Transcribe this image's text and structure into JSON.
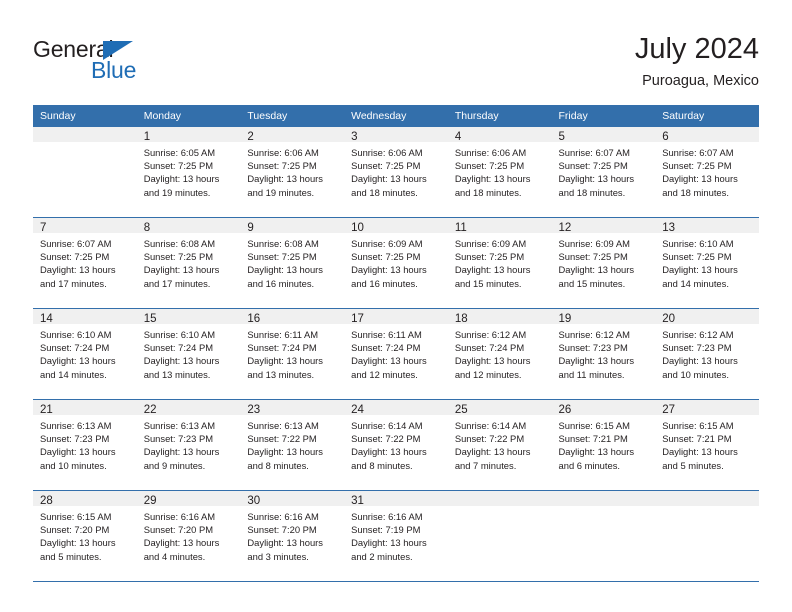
{
  "brand": {
    "name_top": "General",
    "name_bottom": "Blue",
    "triangle_icon": "blue-triangle-icon",
    "accent_color": "#1f6db5"
  },
  "header": {
    "title": "July 2024",
    "subtitle": "Puroagua, Mexico",
    "header_bg_color": "#336fab",
    "daynum_bg_color": "#f0f0f0"
  },
  "weekday_headers": [
    "Sunday",
    "Monday",
    "Tuesday",
    "Wednesday",
    "Thursday",
    "Friday",
    "Saturday"
  ],
  "weeks": [
    [
      {
        "day": "",
        "blank": true,
        "sunrise": "",
        "sunset": "",
        "daylight_line1": "",
        "daylight_line2": ""
      },
      {
        "day": "1",
        "blank": false,
        "sunrise": "Sunrise: 6:05 AM",
        "sunset": "Sunset: 7:25 PM",
        "daylight_line1": "Daylight: 13 hours",
        "daylight_line2": "and 19 minutes."
      },
      {
        "day": "2",
        "blank": false,
        "sunrise": "Sunrise: 6:06 AM",
        "sunset": "Sunset: 7:25 PM",
        "daylight_line1": "Daylight: 13 hours",
        "daylight_line2": "and 19 minutes."
      },
      {
        "day": "3",
        "blank": false,
        "sunrise": "Sunrise: 6:06 AM",
        "sunset": "Sunset: 7:25 PM",
        "daylight_line1": "Daylight: 13 hours",
        "daylight_line2": "and 18 minutes."
      },
      {
        "day": "4",
        "blank": false,
        "sunrise": "Sunrise: 6:06 AM",
        "sunset": "Sunset: 7:25 PM",
        "daylight_line1": "Daylight: 13 hours",
        "daylight_line2": "and 18 minutes."
      },
      {
        "day": "5",
        "blank": false,
        "sunrise": "Sunrise: 6:07 AM",
        "sunset": "Sunset: 7:25 PM",
        "daylight_line1": "Daylight: 13 hours",
        "daylight_line2": "and 18 minutes."
      },
      {
        "day": "6",
        "blank": false,
        "sunrise": "Sunrise: 6:07 AM",
        "sunset": "Sunset: 7:25 PM",
        "daylight_line1": "Daylight: 13 hours",
        "daylight_line2": "and 18 minutes."
      }
    ],
    [
      {
        "day": "7",
        "blank": false,
        "sunrise": "Sunrise: 6:07 AM",
        "sunset": "Sunset: 7:25 PM",
        "daylight_line1": "Daylight: 13 hours",
        "daylight_line2": "and 17 minutes."
      },
      {
        "day": "8",
        "blank": false,
        "sunrise": "Sunrise: 6:08 AM",
        "sunset": "Sunset: 7:25 PM",
        "daylight_line1": "Daylight: 13 hours",
        "daylight_line2": "and 17 minutes."
      },
      {
        "day": "9",
        "blank": false,
        "sunrise": "Sunrise: 6:08 AM",
        "sunset": "Sunset: 7:25 PM",
        "daylight_line1": "Daylight: 13 hours",
        "daylight_line2": "and 16 minutes."
      },
      {
        "day": "10",
        "blank": false,
        "sunrise": "Sunrise: 6:09 AM",
        "sunset": "Sunset: 7:25 PM",
        "daylight_line1": "Daylight: 13 hours",
        "daylight_line2": "and 16 minutes."
      },
      {
        "day": "11",
        "blank": false,
        "sunrise": "Sunrise: 6:09 AM",
        "sunset": "Sunset: 7:25 PM",
        "daylight_line1": "Daylight: 13 hours",
        "daylight_line2": "and 15 minutes."
      },
      {
        "day": "12",
        "blank": false,
        "sunrise": "Sunrise: 6:09 AM",
        "sunset": "Sunset: 7:25 PM",
        "daylight_line1": "Daylight: 13 hours",
        "daylight_line2": "and 15 minutes."
      },
      {
        "day": "13",
        "blank": false,
        "sunrise": "Sunrise: 6:10 AM",
        "sunset": "Sunset: 7:25 PM",
        "daylight_line1": "Daylight: 13 hours",
        "daylight_line2": "and 14 minutes."
      }
    ],
    [
      {
        "day": "14",
        "blank": false,
        "sunrise": "Sunrise: 6:10 AM",
        "sunset": "Sunset: 7:24 PM",
        "daylight_line1": "Daylight: 13 hours",
        "daylight_line2": "and 14 minutes."
      },
      {
        "day": "15",
        "blank": false,
        "sunrise": "Sunrise: 6:10 AM",
        "sunset": "Sunset: 7:24 PM",
        "daylight_line1": "Daylight: 13 hours",
        "daylight_line2": "and 13 minutes."
      },
      {
        "day": "16",
        "blank": false,
        "sunrise": "Sunrise: 6:11 AM",
        "sunset": "Sunset: 7:24 PM",
        "daylight_line1": "Daylight: 13 hours",
        "daylight_line2": "and 13 minutes."
      },
      {
        "day": "17",
        "blank": false,
        "sunrise": "Sunrise: 6:11 AM",
        "sunset": "Sunset: 7:24 PM",
        "daylight_line1": "Daylight: 13 hours",
        "daylight_line2": "and 12 minutes."
      },
      {
        "day": "18",
        "blank": false,
        "sunrise": "Sunrise: 6:12 AM",
        "sunset": "Sunset: 7:24 PM",
        "daylight_line1": "Daylight: 13 hours",
        "daylight_line2": "and 12 minutes."
      },
      {
        "day": "19",
        "blank": false,
        "sunrise": "Sunrise: 6:12 AM",
        "sunset": "Sunset: 7:23 PM",
        "daylight_line1": "Daylight: 13 hours",
        "daylight_line2": "and 11 minutes."
      },
      {
        "day": "20",
        "blank": false,
        "sunrise": "Sunrise: 6:12 AM",
        "sunset": "Sunset: 7:23 PM",
        "daylight_line1": "Daylight: 13 hours",
        "daylight_line2": "and 10 minutes."
      }
    ],
    [
      {
        "day": "21",
        "blank": false,
        "sunrise": "Sunrise: 6:13 AM",
        "sunset": "Sunset: 7:23 PM",
        "daylight_line1": "Daylight: 13 hours",
        "daylight_line2": "and 10 minutes."
      },
      {
        "day": "22",
        "blank": false,
        "sunrise": "Sunrise: 6:13 AM",
        "sunset": "Sunset: 7:23 PM",
        "daylight_line1": "Daylight: 13 hours",
        "daylight_line2": "and 9 minutes."
      },
      {
        "day": "23",
        "blank": false,
        "sunrise": "Sunrise: 6:13 AM",
        "sunset": "Sunset: 7:22 PM",
        "daylight_line1": "Daylight: 13 hours",
        "daylight_line2": "and 8 minutes."
      },
      {
        "day": "24",
        "blank": false,
        "sunrise": "Sunrise: 6:14 AM",
        "sunset": "Sunset: 7:22 PM",
        "daylight_line1": "Daylight: 13 hours",
        "daylight_line2": "and 8 minutes."
      },
      {
        "day": "25",
        "blank": false,
        "sunrise": "Sunrise: 6:14 AM",
        "sunset": "Sunset: 7:22 PM",
        "daylight_line1": "Daylight: 13 hours",
        "daylight_line2": "and 7 minutes."
      },
      {
        "day": "26",
        "blank": false,
        "sunrise": "Sunrise: 6:15 AM",
        "sunset": "Sunset: 7:21 PM",
        "daylight_line1": "Daylight: 13 hours",
        "daylight_line2": "and 6 minutes."
      },
      {
        "day": "27",
        "blank": false,
        "sunrise": "Sunrise: 6:15 AM",
        "sunset": "Sunset: 7:21 PM",
        "daylight_line1": "Daylight: 13 hours",
        "daylight_line2": "and 5 minutes."
      }
    ],
    [
      {
        "day": "28",
        "blank": false,
        "sunrise": "Sunrise: 6:15 AM",
        "sunset": "Sunset: 7:20 PM",
        "daylight_line1": "Daylight: 13 hours",
        "daylight_line2": "and 5 minutes."
      },
      {
        "day": "29",
        "blank": false,
        "sunrise": "Sunrise: 6:16 AM",
        "sunset": "Sunset: 7:20 PM",
        "daylight_line1": "Daylight: 13 hours",
        "daylight_line2": "and 4 minutes."
      },
      {
        "day": "30",
        "blank": false,
        "sunrise": "Sunrise: 6:16 AM",
        "sunset": "Sunset: 7:20 PM",
        "daylight_line1": "Daylight: 13 hours",
        "daylight_line2": "and 3 minutes."
      },
      {
        "day": "31",
        "blank": false,
        "sunrise": "Sunrise: 6:16 AM",
        "sunset": "Sunset: 7:19 PM",
        "daylight_line1": "Daylight: 13 hours",
        "daylight_line2": "and 2 minutes."
      },
      {
        "day": "",
        "blank": true,
        "sunrise": "",
        "sunset": "",
        "daylight_line1": "",
        "daylight_line2": ""
      },
      {
        "day": "",
        "blank": true,
        "sunrise": "",
        "sunset": "",
        "daylight_line1": "",
        "daylight_line2": ""
      },
      {
        "day": "",
        "blank": true,
        "sunrise": "",
        "sunset": "",
        "daylight_line1": "",
        "daylight_line2": ""
      }
    ]
  ]
}
